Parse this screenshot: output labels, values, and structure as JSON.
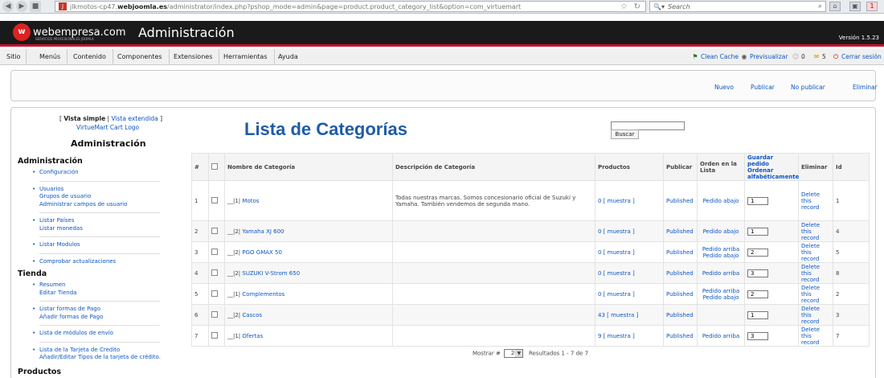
{
  "browser": {
    "url_prefix": "jlkmotos-cp47.",
    "url_domain": "webjoomla.es",
    "url_path": "/administrator/index.php?pshop_mode=admin&page=product.product_category_list&option=com_virtuemart",
    "search_placeholder": "Search"
  },
  "header": {
    "logo_text": "webempresa.com",
    "logo_sub": "SERVICIOS PROFESIONALES JOOMLA",
    "title": "Administración",
    "version": "Versión 1.5.23"
  },
  "menu": {
    "items": [
      "Sitio",
      "Menús",
      "Contenido",
      "Componentes",
      "Extensiones",
      "Herramientas",
      "Ayuda"
    ],
    "clean_cache": "Clean Cache",
    "preview": "Previsualizar",
    "count_a": "0",
    "count_b": "5",
    "logout": "Cerrar sesión"
  },
  "toolbar": {
    "new": "Nuevo",
    "publish": "Publicar",
    "unpublish": "No publicar",
    "delete": "Eliminar"
  },
  "vista": {
    "open": "[ ",
    "simple": "Vista simple",
    "sep": " | ",
    "extended": "Vista extendida",
    "close": " ]",
    "logo": "VirtueMart Cart Logo",
    "admin_title": "Administración"
  },
  "page_title": "Lista de Categorías",
  "search_button": "Buscar",
  "sidebar": {
    "admin_section": "Administración",
    "admin_groups": [
      [
        "Configuración"
      ],
      [
        "Usuarios",
        "Grupos de usuario",
        "Administrar campos de usuario"
      ],
      [
        "Listar Países",
        "Listar monedas"
      ],
      [
        "Listar Modulos"
      ],
      [
        "Comprobar actualizaciones"
      ]
    ],
    "store_section": "Tienda",
    "store_groups": [
      [
        "Resumen",
        "Editar Tienda"
      ],
      [
        "Listar formas de Pago",
        "Añadir formas de Pago"
      ],
      [
        "Lista de módulos de envío"
      ],
      [
        "Lista de la Tarjeta de Credito",
        "Añadir/Editar Tipos de la tarjeta de crédito."
      ]
    ],
    "products_section": "Productos"
  },
  "table": {
    "headers": {
      "num": "#",
      "name": "Nombre de Categoría",
      "desc": "Descripción de Categoría",
      "products": "Productos",
      "publish": "Publicar",
      "order_list": "Orden en la Lista",
      "save_order": "Guardar pedido",
      "sort_alpha": "Ordenar alfabéticamente",
      "delete": "Eliminar",
      "id": "Id"
    },
    "rows": [
      {
        "num": "1",
        "prefix": "__|1|",
        "name": "Motos",
        "desc": "Todas nuestras marcas. Somos concesionario oficial de Suzuki y Yamaha. También vendemos de segunda mano.",
        "count": "0",
        "show": "muestra",
        "status": "Published",
        "up": "",
        "down": "Pedido abajo",
        "order": "1",
        "del": "Delete this record",
        "id": "1"
      },
      {
        "num": "2",
        "prefix": "__|2|",
        "name": "Yamaha XJ 600",
        "desc": "",
        "count": "0",
        "show": "muestra",
        "status": "Published",
        "up": "",
        "down": "Pedido abajo",
        "order": "1",
        "del": "Delete this record",
        "id": "4"
      },
      {
        "num": "3",
        "prefix": "__|2|",
        "name": "PGO GMAX 50",
        "desc": "",
        "count": "0",
        "show": "muestra",
        "status": "Published",
        "up": "Pedido arriba",
        "down": "Pedido abajo",
        "order": "2",
        "del": "Delete this record",
        "id": "5"
      },
      {
        "num": "4",
        "prefix": "__|2|",
        "name": "SUZUKI V-Strom 650",
        "desc": "",
        "count": "0",
        "show": "muestra",
        "status": "Published",
        "up": "Pedido arriba",
        "down": "",
        "order": "3",
        "del": "Delete this record",
        "id": "8"
      },
      {
        "num": "5",
        "prefix": "__|1|",
        "name": "Complementos",
        "desc": "",
        "count": "0",
        "show": "muestra",
        "status": "Published",
        "up": "Pedido arriba",
        "down": "Pedido abajo",
        "order": "2",
        "del": "Delete this record",
        "id": "2"
      },
      {
        "num": "6",
        "prefix": "__|2|",
        "name": "Cascos",
        "desc": "",
        "count": "43",
        "show": "muestra",
        "status": "Published",
        "up": "",
        "down": "",
        "order": "1",
        "del": "Delete this record",
        "id": "3"
      },
      {
        "num": "7",
        "prefix": "__|1|",
        "name": "Ofertas",
        "desc": "",
        "count": "9",
        "show": "muestra",
        "status": "Published",
        "up": "Pedido arriba",
        "down": "",
        "order": "3",
        "del": "Delete this record",
        "id": "7"
      }
    ],
    "footer": {
      "show_label": "Mostrar #",
      "per_page": "20",
      "results": "Resultados 1 - 7 de 7"
    }
  }
}
